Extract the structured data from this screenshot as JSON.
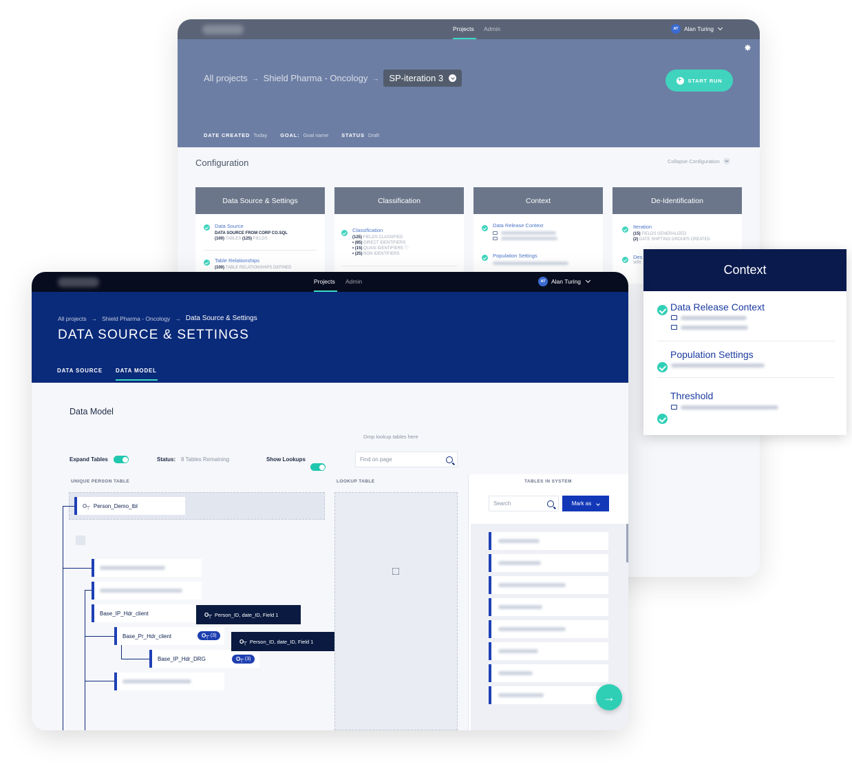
{
  "back_window": {
    "nav": {
      "projects": "Projects",
      "admin": "Admin"
    },
    "user": {
      "initials": "AT",
      "name": "Alan Turing"
    },
    "breadcrumb": {
      "all": "All projects",
      "project": "Shield Pharma - Oncology",
      "current": "SP-iteration 3",
      "sep": "→"
    },
    "start_run": "START RUN",
    "meta": {
      "date_created_label": "DATE CREATED",
      "date_created_value": "Today",
      "goal_label": "GOAL:",
      "goal_value": "Goal name",
      "status_label": "STATUS",
      "status_value": "Draft"
    },
    "configuration": {
      "title": "Configuration",
      "collapse": "Collapse Configuration"
    },
    "cards": [
      {
        "title": "Data Source & Settings",
        "items": [
          {
            "title": "Data Source",
            "line1": "DATA SOURCE FROM CORP CO.SQL",
            "line2_a": "(100)",
            "line2_b": "TABLES",
            "line2_c": "(125)",
            "line2_d": "FIELDS"
          },
          {
            "title": "Table Relationships",
            "line1_a": "(100)",
            "line1_b": "TABLE RELATIONSHIPS DEFINED"
          }
        ]
      },
      {
        "title": "Classification",
        "items": [
          {
            "title": "Classification",
            "lines": [
              {
                "num": "(125)",
                "txt": "FIELDS CLASSIFIED"
              },
              {
                "num": "• (85)",
                "txt": "DIRECT IDENTIFIERS"
              },
              {
                "num": "• (15)",
                "txt": "QUASI IDENTIFIERS ⓘ"
              },
              {
                "num": "• (25)",
                "txt": "NON IDENTIFIERS"
              }
            ]
          }
        ]
      },
      {
        "title": "Context",
        "items": [
          {
            "title": "Data Release Context"
          },
          {
            "title": "Population Settings"
          }
        ]
      },
      {
        "title": "De-Identification",
        "items": [
          {
            "title": "Iteration",
            "line1_a": "(15)",
            "line1_b": "FIELDS GENERALIZED",
            "line2_a": "(2)",
            "line2_b": "DATE SHIFTING GROUPS CREATED"
          },
          {
            "title": "Des",
            "sub": "WRI"
          }
        ]
      }
    ]
  },
  "context_popup": {
    "title": "Context",
    "sections": [
      {
        "title": "Data Release Context"
      },
      {
        "title": "Population Settings"
      },
      {
        "title": "Threshold"
      }
    ]
  },
  "front_window": {
    "nav": {
      "projects": "Projects",
      "admin": "Admin"
    },
    "user": {
      "initials": "AT",
      "name": "Alan Turing"
    },
    "breadcrumb": {
      "all": "All projects",
      "project": "Shield Pharma - Oncology",
      "current": "Data Source & Settings",
      "sep": "→"
    },
    "title": "DATA SOURCE & SETTINGS",
    "tabs": [
      {
        "label": "DATA SOURCE"
      },
      {
        "label": "DATA MODEL"
      }
    ],
    "data_model_title": "Data Model",
    "drop_hint": "Drop lookup tables here",
    "controls": {
      "expand_tables": "Expand Tables",
      "status_label": "Status:",
      "status_value": "8 Tables Remaining",
      "show_lookups": "Show Lookups",
      "find_placeholder": "Find on page"
    },
    "columns": {
      "unique_person": "UNIQUE PERSON TABLE",
      "lookup": "LOOKUP TABLE",
      "tables_in_system": "TABLES IN SYSTEM"
    },
    "tree": {
      "root": "Person_Demo_tbl",
      "base_ip_hdr_client": "Base_IP_Hdr_client",
      "base_pr_hdr_client": "Base_Pr_Hdr_client",
      "base_ip_hdr_drg": "Base_IP_Hdr_DRG",
      "chip_count": "(3)",
      "tooltip_1": "Person_ID, date_ID, Field 1",
      "tooltip_2": "Person_ID, date_ID, Field 1"
    },
    "system": {
      "search_placeholder": "Search",
      "mark_as": "Mark as"
    }
  }
}
